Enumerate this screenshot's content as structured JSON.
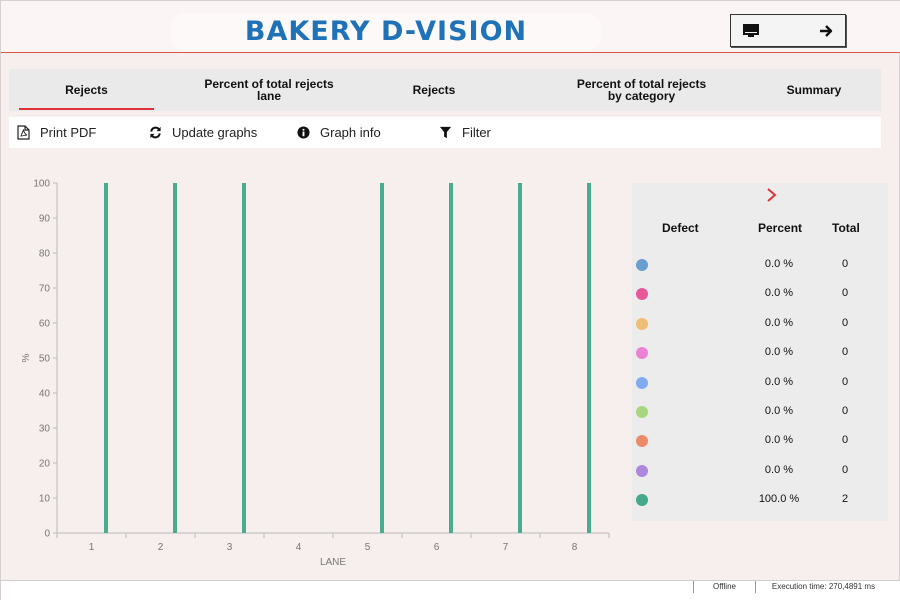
{
  "header": {
    "title": "BAKERY D-VISION",
    "monitor_icon": "monitor-icon",
    "arrow_icon": "arrow-right-icon"
  },
  "tabs": [
    {
      "line1": "Rejects",
      "line2": "",
      "active": true
    },
    {
      "line1": "Percent of total rejects",
      "line2": "lane",
      "active": false
    },
    {
      "line1": "Rejects",
      "line2": "",
      "active": false
    },
    {
      "line1": "Percent of total rejects",
      "line2": "by category",
      "active": false
    },
    {
      "line1": "Summary",
      "line2": "",
      "active": false
    }
  ],
  "toolbar": {
    "print_label": "Print PDF",
    "update_label": "Update graphs",
    "info_label": "Graph info",
    "filter_label": "Filter"
  },
  "colors": {
    "accent_red": "#e0303a",
    "title_blue": "#1f72b8",
    "bar_green": "#4aab8f"
  },
  "chart_data": {
    "type": "bar",
    "xlabel": "LANE",
    "ylabel": "%",
    "x": [
      1,
      2,
      3,
      4,
      5,
      6,
      7,
      8
    ],
    "ylim": [
      0,
      100
    ],
    "yticks": [
      0,
      10,
      20,
      30,
      40,
      50,
      60,
      70,
      80,
      90,
      100
    ],
    "grid": false,
    "series": [
      {
        "values": [
          100,
          100,
          100,
          0,
          100,
          100,
          100,
          100
        ]
      }
    ]
  },
  "legend": {
    "headers": {
      "defect": "Defect",
      "percent": "Percent",
      "total": "Total"
    },
    "rows": [
      {
        "color": "#6a9ecf",
        "percent": "0.0 %",
        "total": "0"
      },
      {
        "color": "#e8579a",
        "percent": "0.0 %",
        "total": "0"
      },
      {
        "color": "#efbd75",
        "percent": "0.0 %",
        "total": "0"
      },
      {
        "color": "#ec82d6",
        "percent": "0.0 %",
        "total": "0"
      },
      {
        "color": "#82aaf0",
        "percent": "0.0 %",
        "total": "0"
      },
      {
        "color": "#a8d67e",
        "percent": "0.0 %",
        "total": "0"
      },
      {
        "color": "#ee8a6b",
        "percent": "0.0 %",
        "total": "0"
      },
      {
        "color": "#ad86de",
        "percent": "0.0 %",
        "total": "0"
      },
      {
        "color": "#45a88a",
        "percent": "100.0 %",
        "total": "2"
      }
    ]
  },
  "status": {
    "connection": "Offline",
    "execution": "Execution time: 270,4891 ms"
  }
}
